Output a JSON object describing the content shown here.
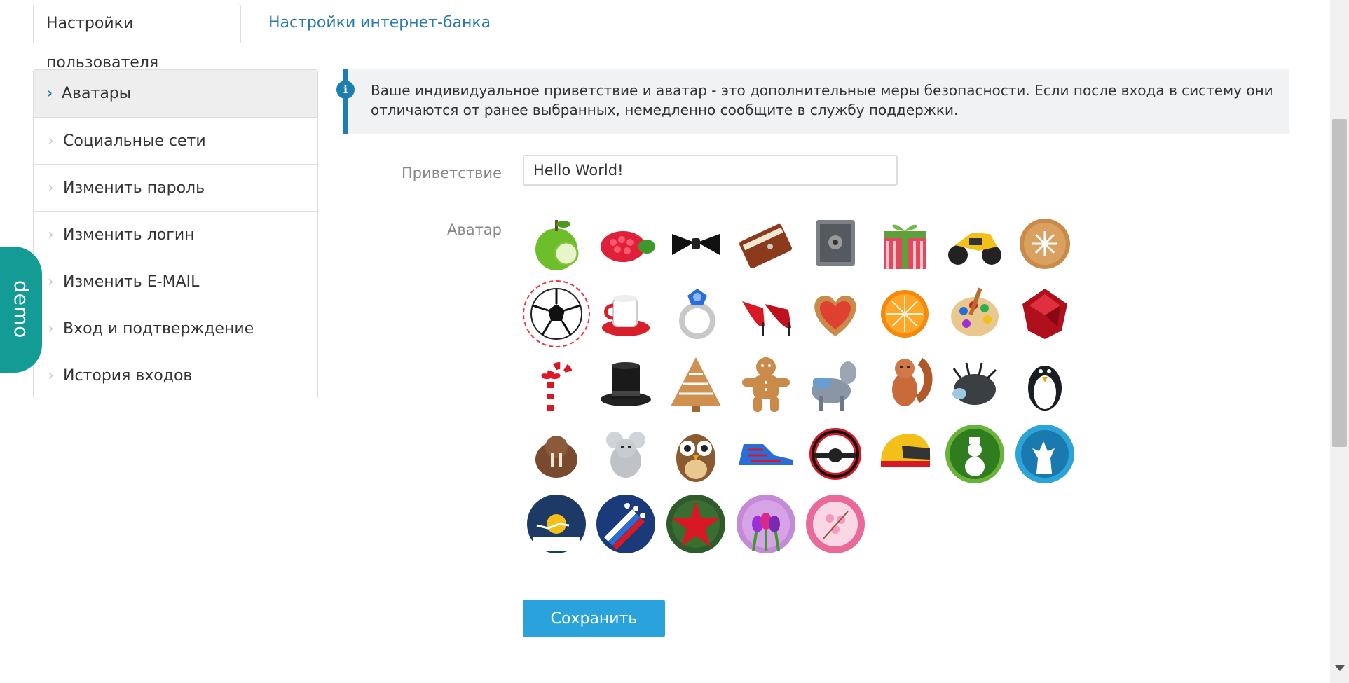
{
  "tabs": [
    {
      "label": "Настройки пользователя",
      "active": true
    },
    {
      "label": "Настройки интернет-банка",
      "active": false
    }
  ],
  "sidebar": {
    "items": [
      {
        "label": "Аватары",
        "active": true
      },
      {
        "label": "Социальные сети"
      },
      {
        "label": "Изменить пароль"
      },
      {
        "label": "Изменить логин"
      },
      {
        "label": "Изменить E-MAIL"
      },
      {
        "label": "Вход и подтверждение"
      },
      {
        "label": "История входов"
      }
    ]
  },
  "demo_label": "demo",
  "info": {
    "icon": "info-icon",
    "text_line1": "Ваше индивидуальное приветствие и аватар - это дополнительные меры безопасности. Если после входа в систему они",
    "text_line2": "отличаются от ранее выбранных, немедленно сообщите в службу поддержки."
  },
  "form": {
    "greeting_label": "Приветствие",
    "greeting_value": "Hello World!",
    "avatar_label": "Аватар",
    "save_label": "Сохранить"
  },
  "avatars": [
    "apple",
    "raspberry",
    "bow-tie",
    "book",
    "safe",
    "gift",
    "motorcycle",
    "cookie",
    "soccer-ball",
    "cup",
    "ring",
    "high-heels",
    "heart-cookie",
    "orange",
    "paint-palette",
    "ruby",
    "candy-cane",
    "top-hat",
    "tree-cookie",
    "gingerbread-man",
    "donkey",
    "squirrel",
    "hedgehog",
    "penguin",
    "walrus",
    "chinchilla",
    "owl",
    "sneaker",
    "steering-wheel",
    "helmet",
    "snowman",
    "deer",
    "santa-sleigh",
    "airshow",
    "red-star",
    "tulips",
    "sakura"
  ],
  "selected_avatar": "soccer-ball",
  "colors": {
    "accent": "#2aa3dd",
    "link": "#2a7ab0",
    "demo": "#139c96",
    "info_bar": "#1c7fb0"
  }
}
